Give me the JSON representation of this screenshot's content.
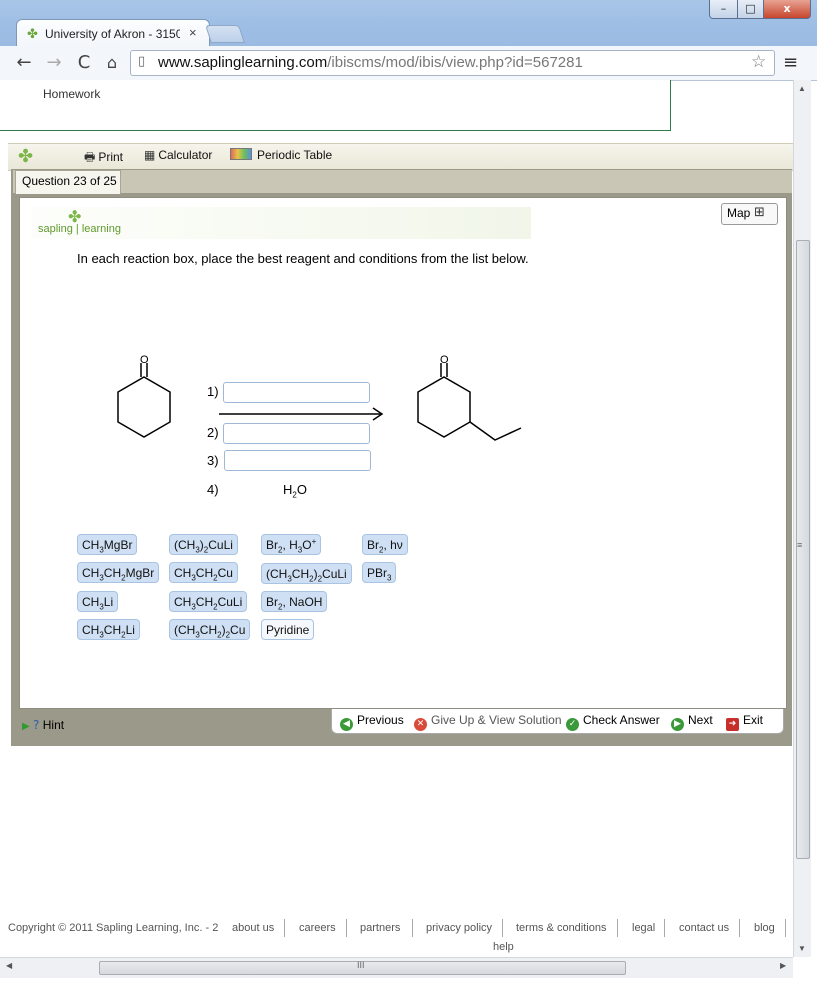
{
  "browser": {
    "tab_title": "University of Akron - 3150",
    "tab_close": "×",
    "url_host": "www.saplinglearning.com",
    "url_path": "/ibiscms/mod/ibis/view.php?id=567281",
    "window_buttons": {
      "minimize": "–",
      "maximize": "□",
      "close": "x"
    },
    "nav": {
      "back": "←",
      "forward": "→",
      "reload": "C",
      "home": "⌂",
      "star": "☆",
      "menu": "≡"
    }
  },
  "page": {
    "homework_label": "Homework",
    "toolbar": {
      "print": "Print",
      "calculator": "Calculator",
      "periodic_table": "Periodic Table"
    },
    "question_tab": "Question 23 of 25",
    "logo": {
      "text_left": "sapling",
      "text_right": "learning"
    },
    "map_button": "Map",
    "instruction": "In each reaction box, place the best reagent and conditions from the list below."
  },
  "reaction": {
    "steps": [
      "1)",
      "2)",
      "3)",
      "4)"
    ],
    "step4_reagent_html": "H<sub>2</sub>O",
    "reactant_atom": "O",
    "product_atom": "O"
  },
  "reagents": [
    {
      "html": "CH<sub>3</sub>MgBr"
    },
    {
      "html": "CH<sub>3</sub>CH<sub>2</sub>MgBr"
    },
    {
      "html": "CH<sub>3</sub>Li"
    },
    {
      "html": "CH<sub>3</sub>CH<sub>2</sub>Li"
    },
    {
      "html": "(CH<sub>3</sub>)<sub>2</sub>CuLi"
    },
    {
      "html": "CH<sub>3</sub>CH<sub>2</sub>Cu"
    },
    {
      "html": "CH<sub>3</sub>CH<sub>2</sub>CuLi"
    },
    {
      "html": "(CH<sub>3</sub>CH<sub>2</sub>)<sub>2</sub>Cu"
    },
    {
      "html": "Br<sub>2</sub>, H<sub>3</sub>O<sup>+</sup>"
    },
    {
      "html": "(CH<sub>3</sub>CH<sub>2</sub>)<sub>2</sub>CuLi"
    },
    {
      "html": "Br<sub>2</sub>, NaOH"
    },
    {
      "html": "Pyridine"
    },
    {
      "html": "Br<sub>2</sub>, hν"
    },
    {
      "html": "PBr<sub>3</sub>"
    }
  ],
  "bottom_nav": {
    "hint": "Hint",
    "previous": "Previous",
    "give_up": "Give Up & View Solution",
    "check": "Check Answer",
    "next": "Next",
    "exit": "Exit"
  },
  "footer": {
    "copyright": "Copyright © 2011 Sapling Learning, Inc. - 2",
    "links": [
      "about us",
      "careers",
      "partners",
      "privacy policy",
      "terms & conditions",
      "legal",
      "contact us",
      "blog",
      "help"
    ]
  },
  "scrollbar_grip": "≡",
  "hscroll_grip": "III",
  "colors": {
    "accent_green": "#7cb548",
    "chip_blue": "#cfe0f4",
    "frame": "#9b998a"
  }
}
